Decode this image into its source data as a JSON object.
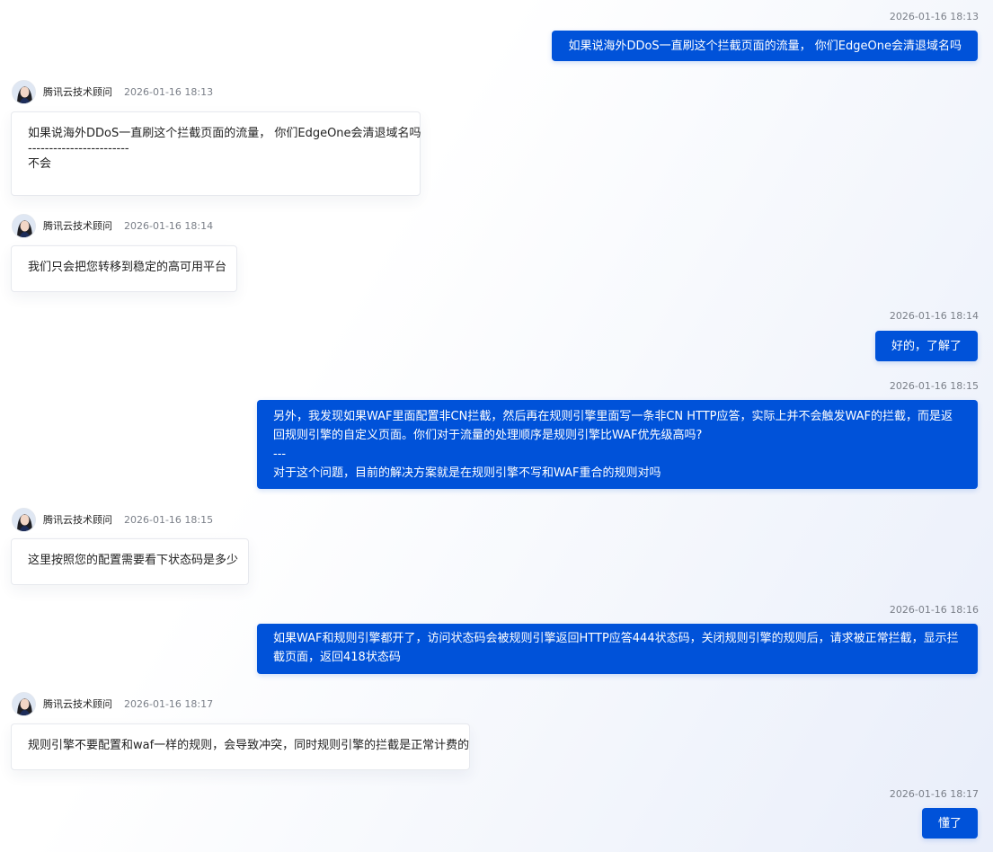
{
  "agent": {
    "name": "腾讯云技术顾问"
  },
  "messages": [
    {
      "id": "m1",
      "from": "user",
      "time": "2026-01-16 18:13",
      "lines": [
        "如果说海外DDoS一直刷这个拦截页面的流量， 你们EdgeOne会清退域名吗"
      ]
    },
    {
      "id": "m2",
      "from": "agent",
      "time": "2026-01-16 18:13",
      "lines": [
        "如果说海外DDoS一直刷这个拦截页面的流量， 你们EdgeOne会清退域名吗",
        "------------------------",
        "不会"
      ]
    },
    {
      "id": "m3",
      "from": "agent",
      "time": "2026-01-16 18:14",
      "lines": [
        "我们只会把您转移到稳定的高可用平台"
      ]
    },
    {
      "id": "m4",
      "from": "user",
      "time": "2026-01-16 18:14",
      "lines": [
        "好的，了解了"
      ]
    },
    {
      "id": "m5",
      "from": "user",
      "time": "2026-01-16 18:15",
      "lines": [
        "另外，我发现如果WAF里面配置非CN拦截，然后再在规则引擎里面写一条非CN HTTP应答，实际上并不会触发WAF的拦截，而是返回规则引擎的自定义页面。你们对于流量的处理顺序是规则引擎比WAF优先级高吗?",
        "---",
        "对于这个问题，目前的解决方案就是在规则引擎不写和WAF重合的规则对吗"
      ]
    },
    {
      "id": "m6",
      "from": "agent",
      "time": "2026-01-16 18:15",
      "lines": [
        "这里按照您的配置需要看下状态码是多少"
      ]
    },
    {
      "id": "m7",
      "from": "user",
      "time": "2026-01-16 18:16",
      "lines": [
        "如果WAF和规则引擎都开了，访问状态码会被规则引擎返回HTTP应答444状态码，关闭规则引擎的规则后，请求被正常拦截，显示拦截页面，返回418状态码"
      ]
    },
    {
      "id": "m8",
      "from": "agent",
      "time": "2026-01-16 18:17",
      "lines": [
        "规则引擎不要配置和waf一样的规则，会导致冲突，同时规则引擎的拦截是正常计费的"
      ]
    },
    {
      "id": "m9",
      "from": "user",
      "time": "2026-01-16 18:17",
      "lines": [
        "懂了"
      ]
    }
  ]
}
